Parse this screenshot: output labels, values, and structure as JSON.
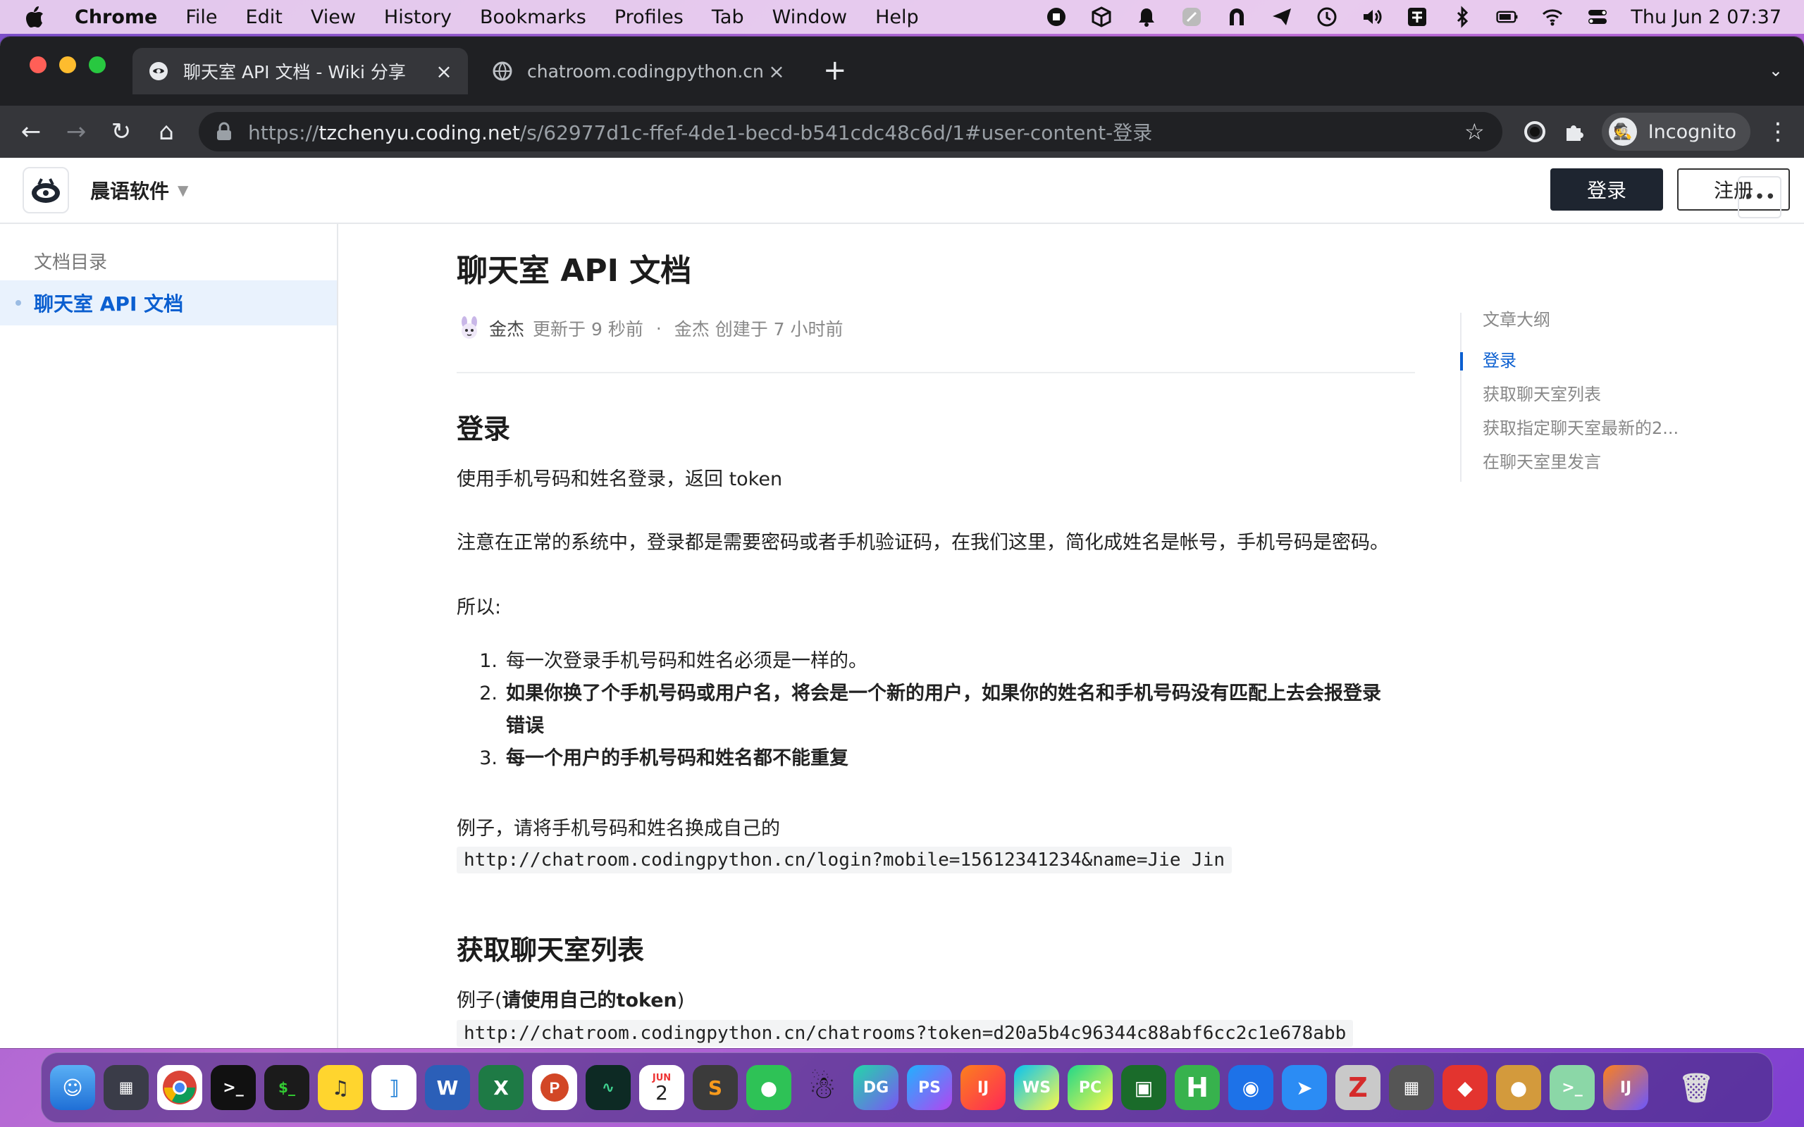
{
  "menubar": {
    "app": "Chrome",
    "items": [
      "File",
      "Edit",
      "View",
      "History",
      "Bookmarks",
      "Profiles",
      "Tab",
      "Window",
      "Help"
    ],
    "clock": "Thu Jun 2  07:37"
  },
  "browser": {
    "tabs": [
      {
        "title": "聊天室 API 文档 - Wiki 分享",
        "close": "×"
      },
      {
        "title": "chatroom.codingpython.cn/login",
        "close": "×"
      }
    ],
    "newtab": "+",
    "url_scheme": "https://",
    "url_host": "tzchenyu.coding.net",
    "url_path": "/s/62977d1c-ffef-4de1-becd-b541cdc48c6d/1#user-content-登录",
    "profile": "Incognito"
  },
  "site": {
    "org": "晨语软件",
    "login": "登录",
    "register": "注册"
  },
  "sidebar": {
    "title": "文档目录",
    "items": [
      {
        "label": "聊天室 API 文档"
      }
    ]
  },
  "doc": {
    "title": "聊天室 API 文档",
    "author": "金杰",
    "updated": "更新于 9 秒前",
    "sep": "·",
    "created": "金杰 创建于 7 小时前",
    "sec1_title": "登录",
    "p1": "使用手机号码和姓名登录，返回 token",
    "p2": "注意在正常的系统中，登录都是需要密码或者手机验证码，在我们这里，简化成姓名是帐号，手机号码是密码。",
    "p3": "所以:",
    "list": [
      {
        "num": "1.",
        "text": "每一次登录手机号码和姓名必须是一样的。"
      },
      {
        "num": "2.",
        "text": "如果你换了个手机号码或用户名，将会是一个新的用户，如果你的姓名和手机号码没有匹配上去会报登录错误"
      },
      {
        "num": "3.",
        "text": "每一个用户的手机号码和姓名都不能重复"
      }
    ],
    "p4": "例子，请将手机号码和姓名换成自己的",
    "code1": "http://chatroom.codingpython.cn/login?mobile=15612341234&name=Jie Jin",
    "sec2_title": "获取聊天室列表",
    "p5_a": "例子(",
    "p5_b": "请使用自己的token",
    "p5_c": ")",
    "code2": "http://chatroom.codingpython.cn/chatrooms?token=d20a5b4c96344c88abf6cc2c1e678abb"
  },
  "outline": {
    "title": "文章大纲",
    "items": [
      "登录",
      "获取聊天室列表",
      "获取指定聊天室最新的2...",
      "在聊天室里发言"
    ]
  },
  "dock": {
    "labels": [
      "DG",
      "PS",
      "IJ",
      "WS",
      "PC",
      "H",
      "Z",
      "IJ"
    ],
    "calendar_month": "JUN",
    "calendar_day": "2"
  },
  "colors": {
    "accent": "#0b5fd0",
    "header_button": "#1e2530"
  }
}
